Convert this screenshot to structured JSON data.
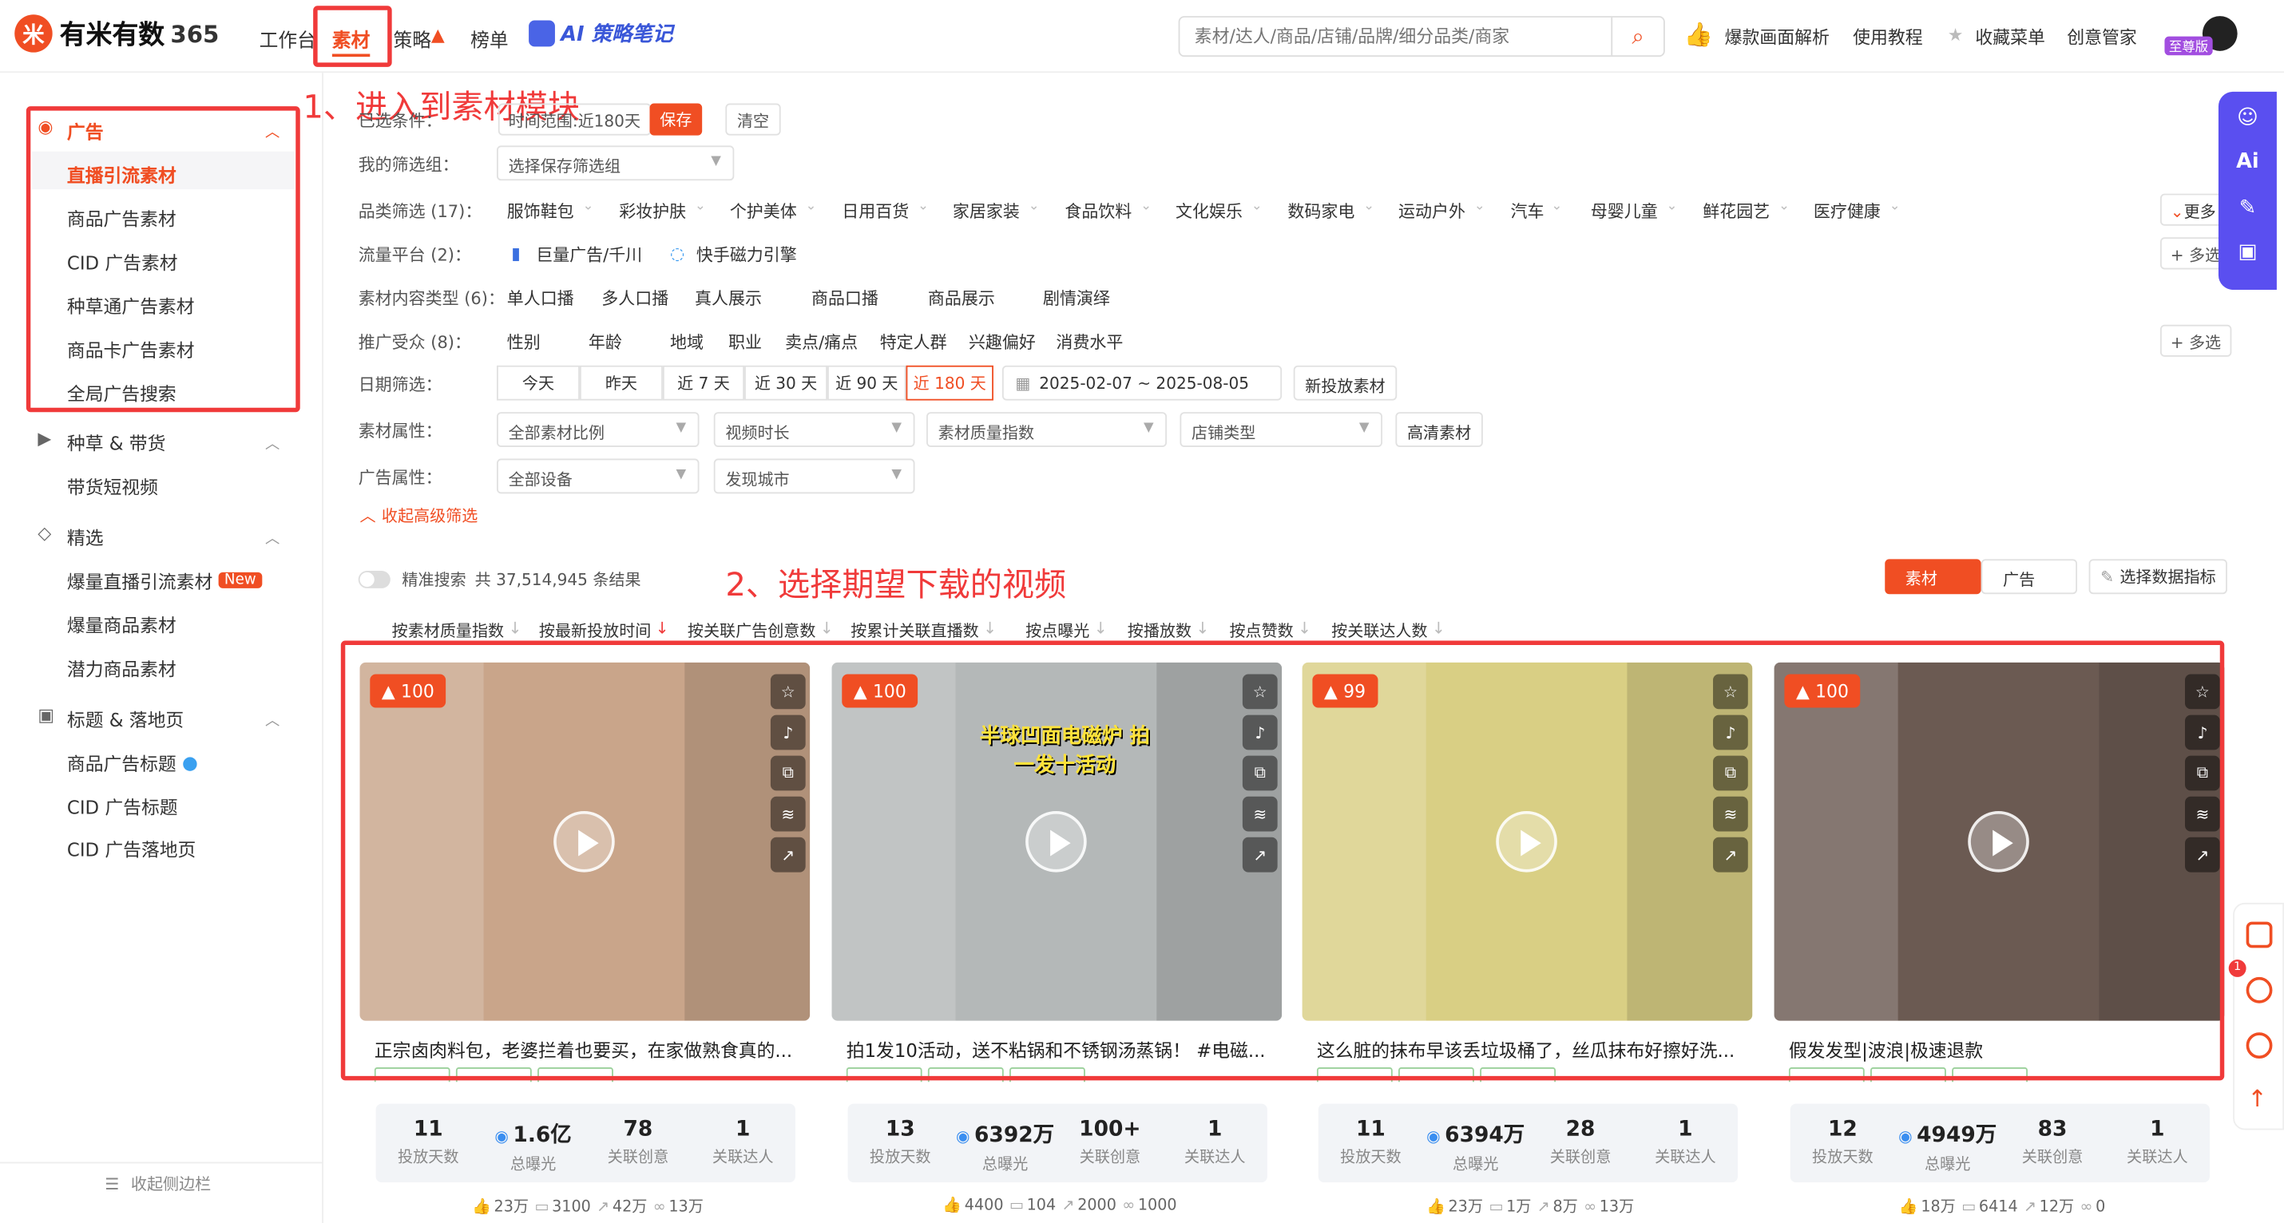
{
  "header": {
    "brand": "有米有数",
    "brand_suffix": "365",
    "nav": [
      "工作台",
      "素材",
      "策略",
      "榜单"
    ],
    "ai_note": "AI 策略笔记",
    "search_placeholder": "素材/达人/商品/店铺/品牌/细分品类/商家",
    "links": [
      "爆款画面解析",
      "使用教程",
      "收藏菜单",
      "创意管家"
    ],
    "vip_badge": "至尊版"
  },
  "annotations": {
    "step1": "1、进入到素材模块",
    "step2": "2、选择期望下载的视频"
  },
  "sidebar": {
    "groups": [
      {
        "title": "广告",
        "items": [
          "直播引流素材",
          "商品广告素材",
          "CID 广告素材",
          "种草通广告素材",
          "商品卡广告素材",
          "全局广告搜索"
        ]
      },
      {
        "title": "种草 & 带货",
        "items": [
          "带货短视频"
        ]
      },
      {
        "title": "精选",
        "items": [
          "爆量直播引流素材",
          "爆量商品素材",
          "潜力商品素材"
        ]
      },
      {
        "title": "标题 & 落地页",
        "items": [
          "商品广告标题",
          "CID 广告标题",
          "CID 广告落地页"
        ]
      }
    ],
    "new_badge": "New",
    "collapse": "收起侧边栏"
  },
  "filters": {
    "selected_label": "已选条件：",
    "selected_value": "时间范围:近180天",
    "save": "保存",
    "clear": "清空",
    "my_group_label": "我的筛选组：",
    "my_group_value": "选择保存筛选组",
    "category_label": "品类筛选 (17)：",
    "categories": [
      "服饰鞋包",
      "彩妆护肤",
      "个护美体",
      "日用百货",
      "家居家装",
      "食品饮料",
      "文化娱乐",
      "数码家电",
      "运动户外",
      "汽车",
      "母婴儿童",
      "鲜花园艺",
      "医疗健康"
    ],
    "more": "更多",
    "platform_label": "流量平台 (2)：",
    "platforms": [
      "巨量广告/千川",
      "快手磁力引擎"
    ],
    "multi": "+ 多选",
    "content_type_label": "素材内容类型 (6)：",
    "content_types": [
      "单人口播",
      "多人口播",
      "真人展示",
      "商品口播",
      "商品展示",
      "剧情演绎"
    ],
    "audience_label": "推广受众 (8)：",
    "audience": [
      "性别",
      "年龄",
      "地域",
      "职业",
      "卖点/痛点",
      "特定人群",
      "兴趣偏好",
      "消费水平"
    ],
    "date_label": "日期筛选：",
    "dates": [
      "今天",
      "昨天",
      "近 7 天",
      "近 30 天",
      "近 90 天",
      "近 180 天"
    ],
    "date_range": "2025-02-07 ~ 2025-08-05",
    "new_material": "新投放素材",
    "attr_label": "素材属性：",
    "attr_selects": [
      "全部素材比例",
      "视频时长",
      "素材质量指数",
      "店铺类型"
    ],
    "hd": "高清素材",
    "ad_attr_label": "广告属性：",
    "ad_selects": [
      "全部设备",
      "发现城市"
    ],
    "collapse_adv": "收起高级筛选"
  },
  "results": {
    "precise": "精准搜索",
    "count": "共 37,514,945 条结果",
    "tab_material": "素材",
    "tab_ad": "广告",
    "choose_metric": "选择数据指标",
    "sorts": [
      "按素材质量指数",
      "按最新投放时间",
      "按关联广告创意数",
      "按累计关联直播数",
      "按点曝光",
      "按播放数",
      "按点赞数",
      "按关联达人数"
    ]
  },
  "stat_labels": [
    "投放天数",
    "总曝光",
    "关联创意",
    "关联达人"
  ],
  "cards": [
    {
      "heat": "100",
      "title": "正宗卤肉料包，老婆拦着也要买，在家做熟食真的...",
      "days": "11",
      "exposure": "1.6亿",
      "creatives": "78",
      "kols": "1",
      "likes": "23万",
      "comments": "3100",
      "shares": "42万",
      "collects": "13万",
      "color": "#c9a58a"
    },
    {
      "heat": "100",
      "title": "拍1发10活动，送不粘锅和不锈钢汤蒸锅！ #电磁...",
      "days": "13",
      "exposure": "6392万",
      "creatives": "100+",
      "kols": "1",
      "likes": "4400",
      "comments": "104",
      "shares": "2000",
      "collects": "1000",
      "color": "#b4b8b8",
      "overlay": "半球凹面电磁炉 拍一发十活动"
    },
    {
      "heat": "99",
      "title": "这么脏的抹布早该丢垃圾桶了，丝瓜抹布好擦好洗...",
      "days": "11",
      "exposure": "6394万",
      "creatives": "28",
      "kols": "1",
      "likes": "23万",
      "comments": "1万",
      "shares": "8万",
      "collects": "13万",
      "color": "#d9cf84"
    },
    {
      "heat": "100",
      "title": "假发发型|波浪|极速退款",
      "days": "12",
      "exposure": "4949万",
      "creatives": "83",
      "kols": "1",
      "likes": "18万",
      "comments": "6414",
      "shares": "12万",
      "collects": "0",
      "color": "#6b5a52"
    }
  ]
}
